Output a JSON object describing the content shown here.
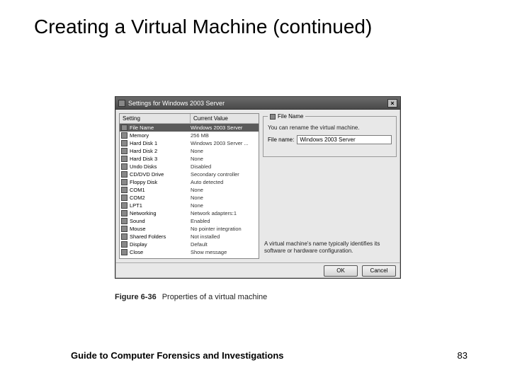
{
  "slide": {
    "title": "Creating a Virtual Machine (continued)",
    "footer_left": "Guide to Computer Forensics and Investigations",
    "page_number": "83"
  },
  "caption": {
    "label": "Figure 6-36",
    "text": "Properties of a virtual machine"
  },
  "dialog": {
    "title": "Settings for Windows 2003 Server",
    "close_glyph": "×",
    "columns": {
      "setting": "Setting",
      "value": "Current Value"
    },
    "settings": [
      {
        "icon": "file-icon",
        "setting": "File Name",
        "value": "Windows 2003 Server",
        "selected": true
      },
      {
        "icon": "memory-icon",
        "setting": "Memory",
        "value": "256 MB"
      },
      {
        "icon": "disk-icon",
        "setting": "Hard Disk 1",
        "value": "Windows 2003 Server ..."
      },
      {
        "icon": "disk-icon",
        "setting": "Hard Disk 2",
        "value": "None"
      },
      {
        "icon": "disk-icon",
        "setting": "Hard Disk 3",
        "value": "None"
      },
      {
        "icon": "undo-icon",
        "setting": "Undo Disks",
        "value": "Disabled"
      },
      {
        "icon": "cd-icon",
        "setting": "CD/DVD Drive",
        "value": "Secondary controller"
      },
      {
        "icon": "floppy-icon",
        "setting": "Floppy Disk",
        "value": "Auto detected"
      },
      {
        "icon": "com-icon",
        "setting": "COM1",
        "value": "None"
      },
      {
        "icon": "com-icon",
        "setting": "COM2",
        "value": "None"
      },
      {
        "icon": "lpt-icon",
        "setting": "LPT1",
        "value": "None"
      },
      {
        "icon": "network-icon",
        "setting": "Networking",
        "value": "Network adapters:1"
      },
      {
        "icon": "sound-icon",
        "setting": "Sound",
        "value": "Enabled"
      },
      {
        "icon": "mouse-icon",
        "setting": "Mouse",
        "value": "No pointer integration"
      },
      {
        "icon": "folder-icon",
        "setting": "Shared Folders",
        "value": "Not installed"
      },
      {
        "icon": "display-icon",
        "setting": "Display",
        "value": "Default"
      },
      {
        "icon": "close-icon",
        "setting": "Close",
        "value": "Show message"
      }
    ],
    "right": {
      "group_title": "File Name",
      "description": "You can rename the virtual machine.",
      "field_label": "File name:",
      "field_value": "Windows 2003 Server",
      "hint": "A virtual machine's name typically identifies its software or hardware configuration."
    },
    "buttons": {
      "ok": "OK",
      "cancel": "Cancel"
    }
  }
}
